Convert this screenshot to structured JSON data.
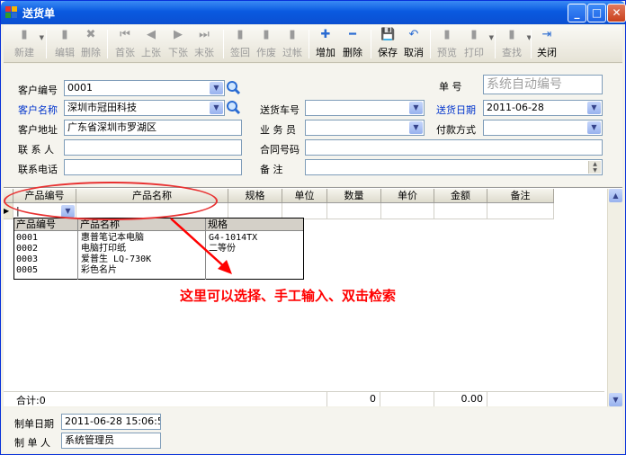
{
  "window": {
    "title": "送货单",
    "colors": {
      "titlebar": "#0a5ae0",
      "annotation": "#ff0000",
      "label_blue": "#0033cc"
    }
  },
  "toolbar": {
    "new": "新建",
    "edit": "编辑",
    "delete": "删除",
    "first": "首张",
    "prev": "上张",
    "next": "下张",
    "last": "末张",
    "sign_back": "签回",
    "void": "作废",
    "post": "过帐",
    "add": "增加",
    "remove": "删除",
    "save": "保存",
    "cancel": "取消",
    "preview": "预览",
    "print": "打印",
    "find": "查找",
    "close": "关闭"
  },
  "form": {
    "customer_code_label": "客户编号",
    "customer_code": "0001",
    "customer_name_label": "客户名称",
    "customer_name": "深圳市冠田科技",
    "customer_addr_label": "客户地址",
    "customer_addr": "广东省深圳市罗湖区",
    "contact_label": "联 系 人",
    "contact": "",
    "phone_label": "联系电话",
    "phone": "",
    "order_no_label": "单    号",
    "order_no_placeholder": "系统自动编号",
    "vehicle_label": "送货车号",
    "vehicle": "",
    "delivery_date_label": "送货日期",
    "delivery_date": "2011-06-28",
    "salesman_label": "业 务 员",
    "salesman": "",
    "payment_label": "付款方式",
    "payment": "",
    "contract_label": "合同号码",
    "contract": "",
    "remark_label": "备    注",
    "remark": ""
  },
  "grid": {
    "columns": [
      "产品编号",
      "产品名称",
      "规格",
      "单位",
      "数量",
      "单价",
      "金额",
      "备注"
    ],
    "current_input": "|"
  },
  "popup": {
    "columns": [
      "产品编号",
      "产品名称",
      "规格"
    ],
    "rows": [
      {
        "code": "0001",
        "name": "惠普笔记本电脑",
        "spec": "G4-1014TX"
      },
      {
        "code": "0002",
        "name": "电脑打印纸",
        "spec": "二等份"
      },
      {
        "code": "0003",
        "name": "爱普生 LQ-730K",
        "spec": ""
      },
      {
        "code": "0005",
        "name": "彩色名片",
        "spec": ""
      }
    ]
  },
  "annotation": "这里可以选择、手工输入、双击检索",
  "totals": {
    "label": "合计:0",
    "quantity": "0",
    "amount": "0.00"
  },
  "footer": {
    "made_date_label": "制单日期",
    "made_date": "2011-06-28 15:06:55",
    "maker_label": "制 单 人",
    "maker": "系统管理员"
  }
}
